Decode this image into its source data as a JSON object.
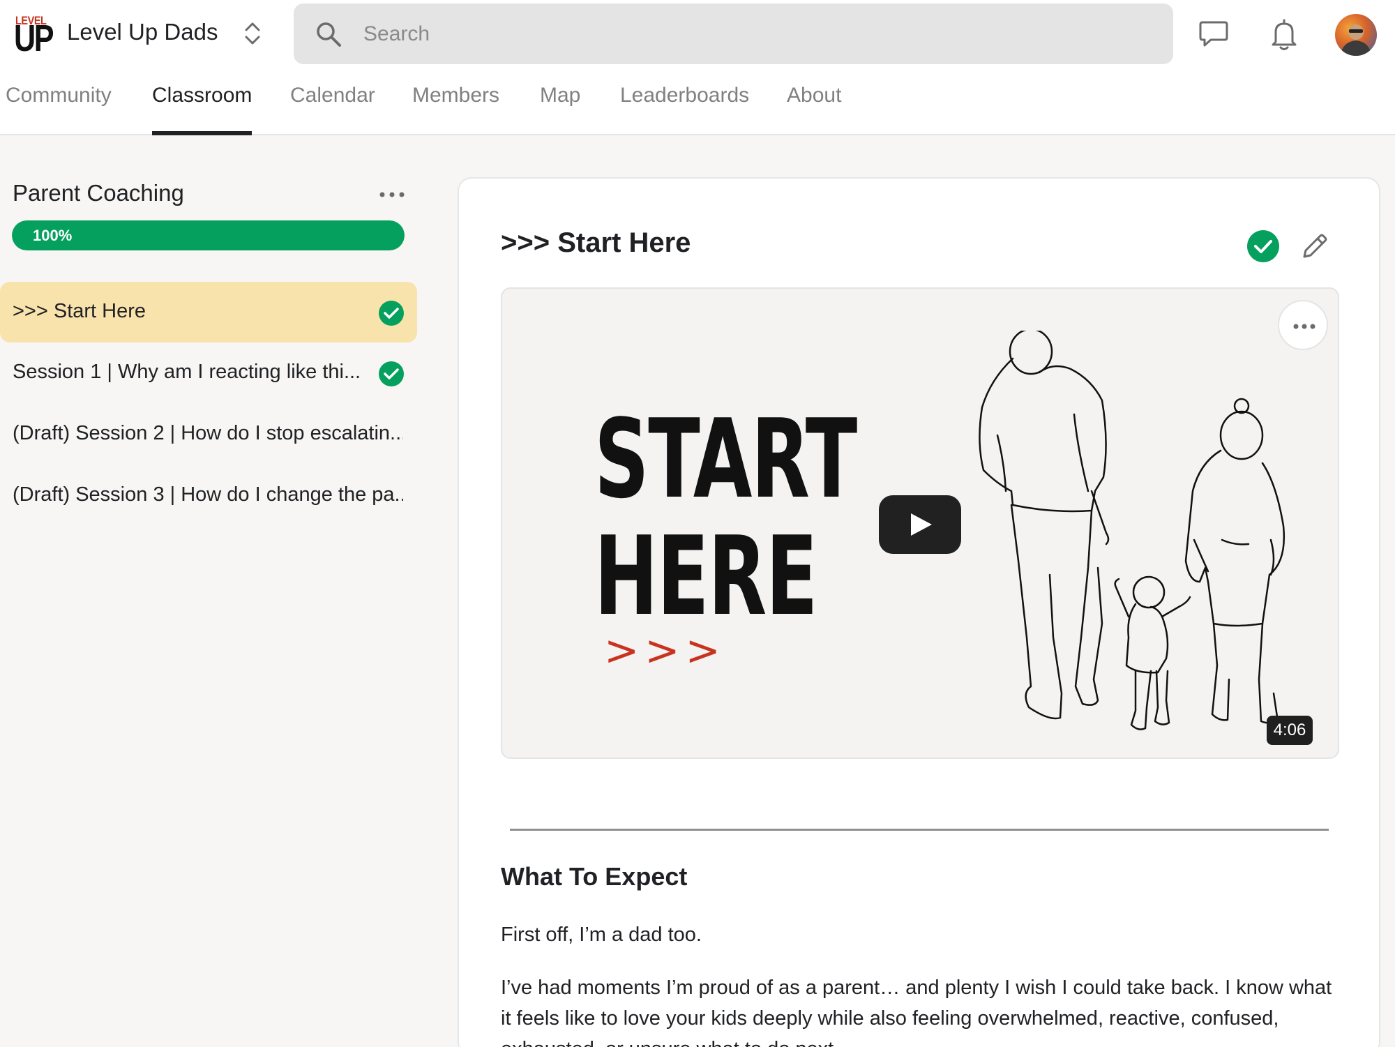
{
  "brand": {
    "logo_small": "LEVEL",
    "logo_large": "UP",
    "name": "Level Up Dads"
  },
  "search": {
    "placeholder": "Search",
    "value": ""
  },
  "nav": {
    "tabs": [
      {
        "label": "Community"
      },
      {
        "label": "Classroom"
      },
      {
        "label": "Calendar"
      },
      {
        "label": "Members"
      },
      {
        "label": "Map"
      },
      {
        "label": "Leaderboards"
      },
      {
        "label": "About"
      }
    ],
    "active_tab": "Classroom"
  },
  "course": {
    "title": "Parent Coaching",
    "progress_label": "100%",
    "progress": 1.0,
    "lessons": [
      {
        "label": ">>> Start Here",
        "completed": true,
        "active": true
      },
      {
        "label": "Session 1 | Why am I reacting like thi...",
        "completed": true,
        "active": false
      },
      {
        "label": "(Draft) Session 2 | How do I stop escalatin...",
        "completed": false,
        "active": false
      },
      {
        "label": "(Draft) Session 3 | How do I change the pa...",
        "completed": false,
        "active": false
      }
    ]
  },
  "lesson": {
    "title": ">>> Start Here",
    "video": {
      "thumbnail_title_line1": "START",
      "thumbnail_title_line2": "HERE",
      "thumbnail_arrows": ">>>",
      "duration": "4:06"
    },
    "section_heading": "What To Expect",
    "paragraphs": [
      "First off, I’m a dad too.",
      "I’ve had moments I’m proud of as a parent… and plenty I wish I could take back. I know what it feels like to love your kids deeply while also feeling overwhelmed, reactive, confused, exhausted, or unsure what to do next."
    ]
  },
  "colors": {
    "accent_green": "#06a05e",
    "active_lesson_bg": "#f9e3ac",
    "brand_red": "#c8331f"
  },
  "icons": [
    "switch-icon",
    "search-icon",
    "chat-icon",
    "bell-icon",
    "more-icon",
    "check-circle-icon",
    "pencil-icon",
    "play-icon"
  ]
}
